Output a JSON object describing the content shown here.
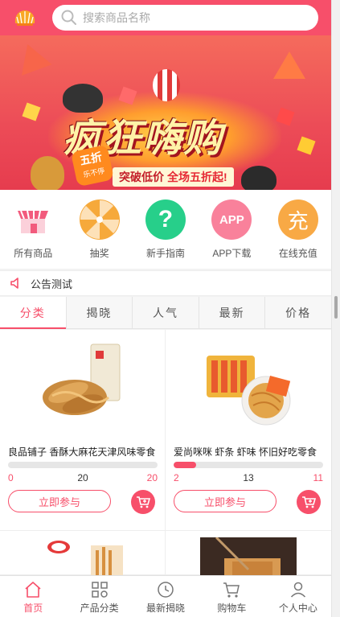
{
  "header": {
    "logo_icon": "shell-logo-icon",
    "search_placeholder": "搜索商品名称",
    "search_icon": "search-icon"
  },
  "banner": {
    "title": "疯狂嗨购",
    "subtitle_a": "突破低价",
    "subtitle_b": "全场五折起!",
    "badge_main": "五折",
    "badge_sub": "乐不停"
  },
  "quicknav": [
    {
      "label": "所有商品",
      "icon": "shop-icon",
      "color": "#f25b7d"
    },
    {
      "label": "抽奖",
      "icon": "lottery-wheel-icon",
      "color": "#f6a93b"
    },
    {
      "label": "新手指南",
      "icon": "question-icon",
      "glyph": "?",
      "color": "#27cf8a"
    },
    {
      "label": "APP下载",
      "icon": "app-icon",
      "glyph": "APP",
      "color": "#f9819b"
    },
    {
      "label": "在线充值",
      "icon": "recharge-icon",
      "glyph": "充",
      "color": "#f8a945"
    }
  ],
  "notice": {
    "icon": "speaker-icon",
    "text": "公告测试"
  },
  "tabs": [
    {
      "label": "分类",
      "active": true
    },
    {
      "label": "揭晓",
      "active": false
    },
    {
      "label": "人气",
      "active": false
    },
    {
      "label": "最新",
      "active": false
    },
    {
      "label": "价格",
      "active": false
    }
  ],
  "products": [
    {
      "name": "良品铺子 香酥大麻花天津风味零食",
      "joined": "0",
      "total": "20",
      "remaining": "20",
      "progress": 0.0,
      "button": "立即参与"
    },
    {
      "name": "爱尚咪咪 虾条 虾味 怀旧好吃零食",
      "joined": "2",
      "total": "13",
      "remaining": "11",
      "progress": 0.15,
      "button": "立即参与"
    }
  ],
  "bottomnav": [
    {
      "label": "首页",
      "icon": "home-icon",
      "active": true
    },
    {
      "label": "产品分类",
      "icon": "category-icon",
      "active": false
    },
    {
      "label": "最新揭晓",
      "icon": "clock-icon",
      "active": false
    },
    {
      "label": "购物车",
      "icon": "cart-icon",
      "active": false
    },
    {
      "label": "个人中心",
      "icon": "user-icon",
      "active": false
    }
  ],
  "colors": {
    "accent": "#f74f6a",
    "tab_bg": "#f7f7f7"
  }
}
